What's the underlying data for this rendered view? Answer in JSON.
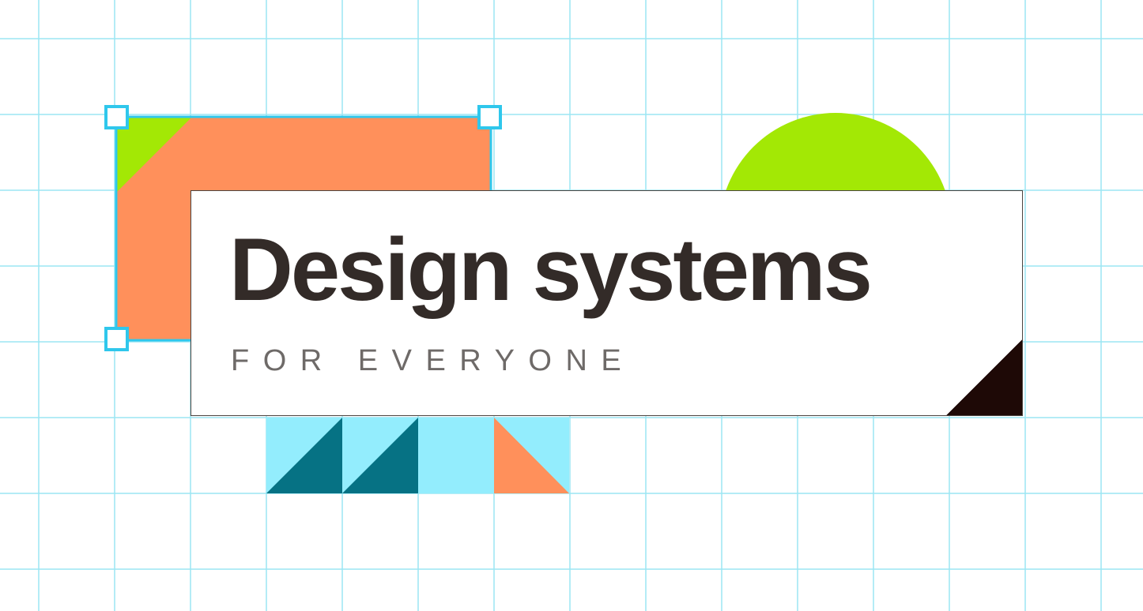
{
  "title": "Design systems",
  "subtitle": "FOR EVERYONE",
  "colors": {
    "grid_line": "#9be6f3",
    "selection": "#2fc7ec",
    "lime": "#a3e805",
    "orange": "#ff905b",
    "light_cyan": "#93edfd",
    "teal": "#067284",
    "text_dark": "#332b28",
    "text_gray": "#6e6a68",
    "corner_dark": "#1e0906"
  }
}
